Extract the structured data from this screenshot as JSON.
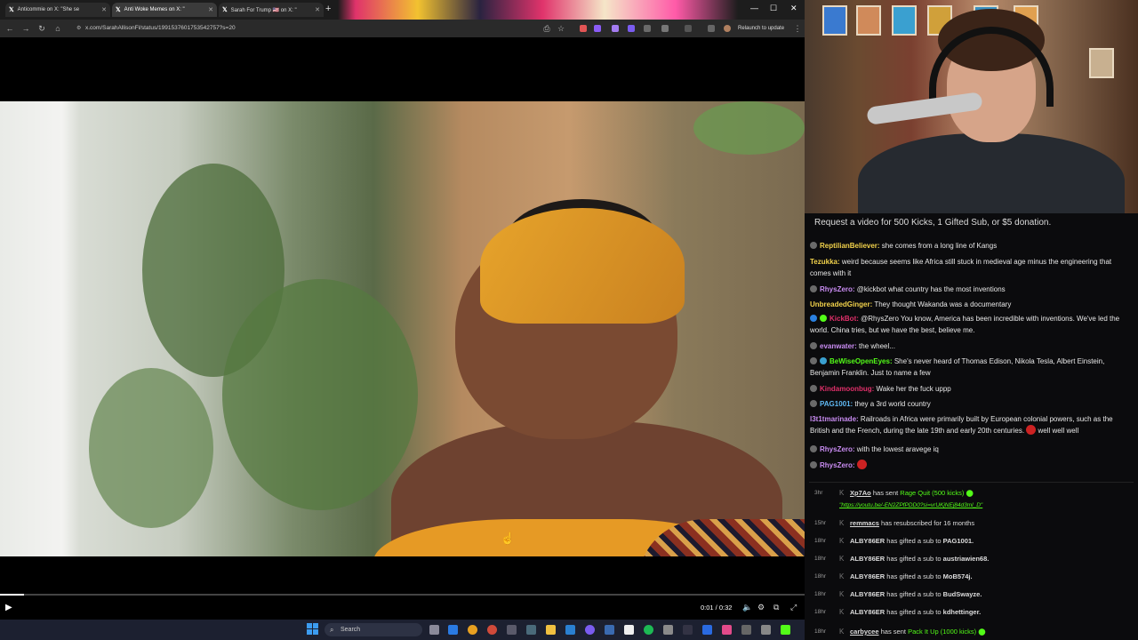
{
  "browser": {
    "tabs": [
      {
        "label": "Anticommie on X: \"She se"
      },
      {
        "label": "Anti Woke Memes on X: \""
      },
      {
        "label": "Sarah For Trump 🇺🇸 on X: \""
      }
    ],
    "url": "x.com/SarahAllisonFl/status/1991537601753542757?s=20",
    "relaunch_label": "Relaunch to update"
  },
  "video": {
    "timecode": "0:01 / 0:32",
    "progress": 0.03
  },
  "taskbar": {
    "search_label": "Search"
  },
  "chat": {
    "banner": "Request a video for 500 Kicks, 1 Gifted Sub, or $5 donation.",
    "messages": [
      {
        "user": "ReptilianBeliever:",
        "text": " she comes from a long line of Kangs",
        "color": "#f2d24b"
      },
      {
        "user": "Tezukka:",
        "text": " weird because seems like Africa still stuck in medieval age minus the engineering that comes with it",
        "color": "#f2d24b"
      },
      {
        "user": "RhysZero:",
        "text": " @kickbot what country has the most inventions",
        "color": "#c98cf2"
      },
      {
        "user": "UnbreadedGinger:",
        "text": " They thought Wakanda was a documentary",
        "color": "#f2d24b"
      },
      {
        "user": "KickBot:",
        "text": " @RhysZero You know, America has been incredible with inventions. We've led the world. China tries, but we have the best, believe me.",
        "color": "#e0306a"
      },
      {
        "user": "evanwater:",
        "text": " the wheel...",
        "color": "#c98cf2"
      },
      {
        "user": "BeWiseOpenEyes:",
        "text": " She's never heard of Thomas Edison, Nikola Tesla, Albert Einstein, Benjamin Franklin. Just to name a few",
        "color": "#53fc18"
      },
      {
        "user": "Kindamoonbug:",
        "text": " Wake her the fuck uppp",
        "color": "#e0306a"
      },
      {
        "user": "PAG1001:",
        "text": " they a 3rd world country",
        "color": "#5fb8f2"
      },
      {
        "user": "l3t1tmarinade:",
        "text": " Railroads in Africa were primarily built by European colonial powers, such as the British and the French, during the late 19th and early 20th centuries.",
        "text2": " well well well",
        "color": "#c98cf2"
      },
      {
        "user": "RhysZero:",
        "text": " with the lowest aravege iq",
        "color": "#c98cf2"
      },
      {
        "user": "RhysZero:",
        "text": "",
        "color": "#c98cf2"
      }
    ],
    "events": [
      {
        "age": "3hr",
        "user": "Xp7Ao",
        "text": " has sent ",
        "reward": "Rage Quit (500 kicks)"
      },
      {
        "age": "15hr",
        "user": "remmacs",
        "text": " has resubscribed for 16 months",
        "reward": ""
      },
      {
        "age": "18hr",
        "user": "ALBY86ER",
        "text": " has gifted a sub to ",
        "target": "PAG1001."
      },
      {
        "age": "18hr",
        "user": "ALBY86ER",
        "text": " has gifted a sub to ",
        "target": "austriawien68."
      },
      {
        "age": "18hr",
        "user": "ALBY86ER",
        "text": " has gifted a sub to ",
        "target": "MoB574j."
      },
      {
        "age": "18hr",
        "user": "ALBY86ER",
        "text": " has gifted a sub to ",
        "target": "BudSwayze."
      },
      {
        "age": "18hr",
        "user": "ALBY86ER",
        "text": " has gifted a sub to ",
        "target": "kdhettinger."
      },
      {
        "age": "18hr",
        "user": "carbycee",
        "text": " has sent ",
        "reward": "Pack It Up (1000 kicks)"
      }
    ],
    "event_link": "\"https://youtu.be/-EN2ZPfPDD0?si=vrUKjNEj84d3ml_D\""
  }
}
